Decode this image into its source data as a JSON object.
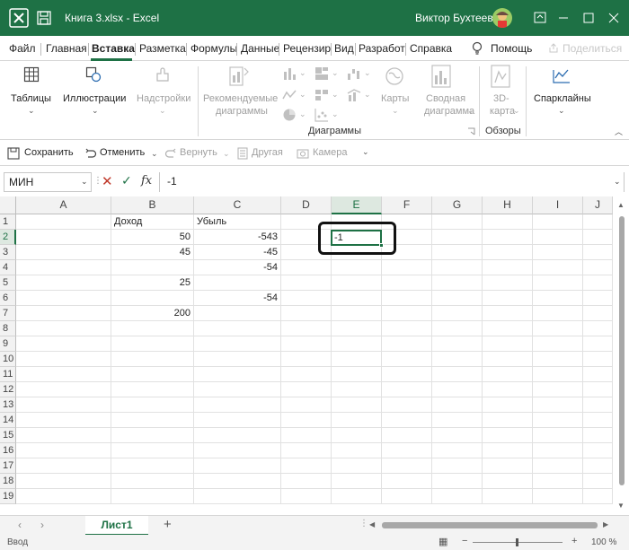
{
  "titlebar": {
    "title": "Книга 3.xlsx  -  Excel",
    "user": "Виктор Бухтеев",
    "accent": "#1e7145"
  },
  "menu": {
    "tabs": [
      "Файл",
      "Главная",
      "Вставка",
      "Разметка",
      "Формулы",
      "Данные",
      "Рецензир",
      "Вид",
      "Разработ",
      "Справка"
    ],
    "active": "Вставка",
    "help_search": "Помощь",
    "share": "Поделиться"
  },
  "ribbon": {
    "tables": "Таблицы",
    "illustrations": "Иллюстрации",
    "addins": "Надстройки",
    "recommended_charts": [
      "Рекомендуемые",
      "диаграммы"
    ],
    "maps": "Карты",
    "pivot_chart": [
      "Сводная",
      "диаграмма"
    ],
    "map3d": [
      "3D-",
      "карта"
    ],
    "sparklines": "Спарклайны",
    "group_charts": "Диаграммы",
    "group_tours": "Обзоры"
  },
  "qat": {
    "save": "Сохранить",
    "undo": "Отменить",
    "redo": "Вернуть",
    "other": "Другая",
    "camera": "Камера"
  },
  "formula_bar": {
    "name_box": "МИН",
    "formula": "-1"
  },
  "grid": {
    "columns": [
      "A",
      "B",
      "C",
      "D",
      "E",
      "F",
      "G",
      "H",
      "I",
      "J"
    ],
    "rows": [
      "1",
      "2",
      "3",
      "4",
      "5",
      "6",
      "7",
      "8",
      "9",
      "10",
      "11",
      "12",
      "13",
      "14",
      "15",
      "16",
      "17",
      "18",
      "19"
    ],
    "selected_column": "E",
    "selected_row": "2",
    "cells": {
      "B1": "Доход",
      "C1": "Убыль",
      "B2": "50",
      "C2": "-543",
      "B3": "45",
      "C3": "-45",
      "C4": "-54",
      "B5": "25",
      "C6": "-54",
      "B7": "200"
    },
    "active_cell_value": "-1"
  },
  "sheets": {
    "tabs": [
      "Лист1"
    ],
    "add": "+"
  },
  "status": {
    "mode": "Ввод",
    "zoom": "100 %"
  }
}
